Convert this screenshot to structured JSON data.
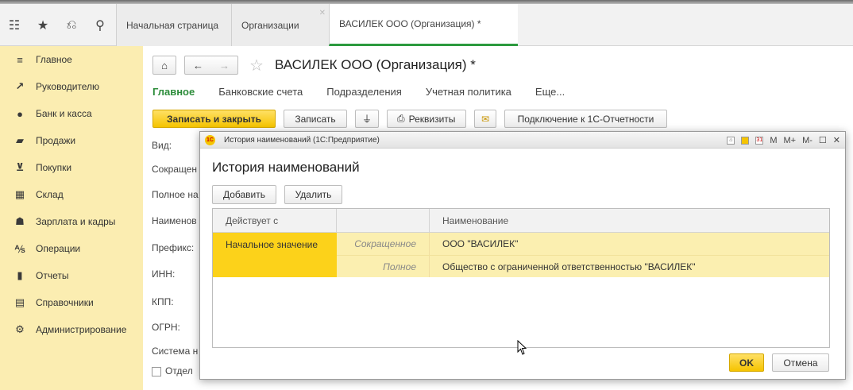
{
  "top_icons": [
    {
      "name": "apps-grid-icon",
      "glyph": "☷"
    },
    {
      "name": "favorites-star-icon",
      "glyph": "★"
    },
    {
      "name": "history-icon",
      "glyph": "⎌"
    },
    {
      "name": "search-icon",
      "glyph": "⚲"
    }
  ],
  "tabs": [
    {
      "label": "Начальная страница",
      "closable": false,
      "active": false
    },
    {
      "label": "Организации",
      "closable": true,
      "active": false
    },
    {
      "label": "ВАСИЛЕК ООО (Организация) *",
      "closable": true,
      "active": true
    }
  ],
  "sidebar": {
    "items": [
      {
        "label": "Главное",
        "icon": "menu-lines-icon",
        "glyph": "≡"
      },
      {
        "label": "Руководителю",
        "icon": "trend-chart-icon",
        "glyph": "↗"
      },
      {
        "label": "Банк и касса",
        "icon": "coin-icon",
        "glyph": "●"
      },
      {
        "label": "Продажи",
        "icon": "shopping-bag-icon",
        "glyph": "▰"
      },
      {
        "label": "Покупки",
        "icon": "cart-icon",
        "glyph": "⊻"
      },
      {
        "label": "Склад",
        "icon": "warehouse-icon",
        "glyph": "▦"
      },
      {
        "label": "Зарплата и кадры",
        "icon": "person-icon",
        "glyph": "☗"
      },
      {
        "label": "Операции",
        "icon": "operations-icon",
        "glyph": "⅍"
      },
      {
        "label": "Отчеты",
        "icon": "bar-chart-icon",
        "glyph": "▮"
      },
      {
        "label": "Справочники",
        "icon": "books-icon",
        "glyph": "▤"
      },
      {
        "label": "Администрирование",
        "icon": "gear-icon",
        "glyph": "⚙"
      }
    ]
  },
  "form": {
    "title": "ВАСИЛЕК ООО (Организация) *",
    "home_glyph": "⌂",
    "back_glyph": "←",
    "forward_glyph": "→",
    "star_glyph": "☆",
    "tabs": [
      "Главное",
      "Банковские счета",
      "Подразделения",
      "Учетная политика",
      "Еще..."
    ],
    "toolbar": {
      "save_close": "Записать и закрыть",
      "save": "Записать",
      "attach_glyph": "⏚",
      "requisites": "Реквизиты",
      "print_glyph": "⎙",
      "mail_glyph": "✉",
      "connect": "Подключение к 1С-Отчетности"
    },
    "fields": [
      "Вид:",
      "Сокращен",
      "Полное на",
      "Наименов",
      "Префикс:",
      "ИНН:",
      "КПП:",
      "ОГРН:",
      "Система н",
      "Отдел"
    ]
  },
  "dialog": {
    "window_title": "История наименований (1С:Предприятие)",
    "logo": "1С",
    "window_controls": [
      "M",
      "M+",
      "M-"
    ],
    "heading": "История наименований",
    "add_label": "Добавить",
    "delete_label": "Удалить",
    "columns": [
      "Действует с",
      "",
      "Наименование"
    ],
    "rows": [
      {
        "valid_from": "Начальное значение",
        "kind": "Сокращенное",
        "name": "ООО \"ВАСИЛЕК\""
      },
      {
        "valid_from": "",
        "kind": "Полное",
        "name": "Общество с ограниченной ответственностью \"ВАСИЛЕК\""
      }
    ],
    "ok_label": "OK",
    "cancel_label": "Отмена"
  }
}
